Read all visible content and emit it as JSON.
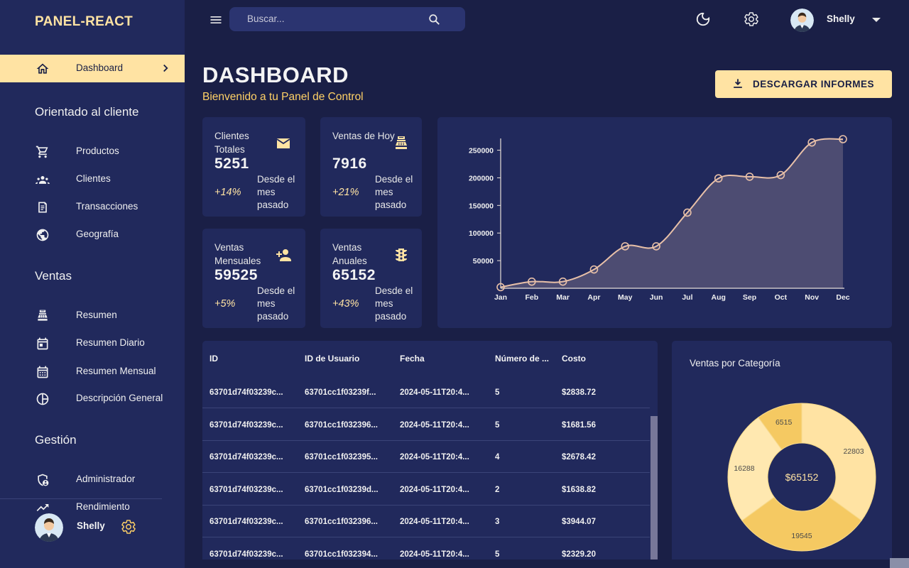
{
  "brand": "PANEL-REACT",
  "sidebar": {
    "active": {
      "label": "Dashboard"
    },
    "sections": [
      {
        "title": "Orientado al cliente",
        "items": [
          {
            "label": "Productos",
            "icon": "shopping-cart-icon"
          },
          {
            "label": "Clientes",
            "icon": "groups-icon"
          },
          {
            "label": "Transacciones",
            "icon": "receipt-icon"
          },
          {
            "label": "Geografía",
            "icon": "globe-icon"
          }
        ]
      },
      {
        "title": "Ventas",
        "items": [
          {
            "label": "Resumen",
            "icon": "point-of-sale-icon"
          },
          {
            "label": "Resumen Diario",
            "icon": "calendar-today-icon"
          },
          {
            "label": "Resumen Mensual",
            "icon": "calendar-month-icon"
          },
          {
            "label": "Descripción General",
            "icon": "pie-chart-icon"
          }
        ]
      },
      {
        "title": "Gestión",
        "items": [
          {
            "label": "Administrador",
            "icon": "admin-icon"
          },
          {
            "label": "Rendimiento",
            "icon": "trending-up-icon"
          }
        ]
      }
    ],
    "user": "Shelly"
  },
  "topbar": {
    "search_placeholder": "Buscar...",
    "user": "Shelly"
  },
  "header": {
    "title": "DASHBOARD",
    "subtitle": "Bienvenido a tu Panel de Control",
    "download_label": "DESCARGAR INFORMES"
  },
  "stats": [
    {
      "title": "Clientes Totales",
      "value": "5251",
      "increase": "+14%",
      "desc": "Desde el mes pasado",
      "icon": "email-icon"
    },
    {
      "title": "Ventas de Hoy",
      "value": "7916",
      "increase": "+21%",
      "desc": "Desde el mes pasado",
      "icon": "point-of-sale-icon"
    },
    {
      "title": "Ventas Mensuales",
      "value": "59525",
      "increase": "+5%",
      "desc": "Desde el mes pasado",
      "icon": "person-add-icon"
    },
    {
      "title": "Ventas Anuales",
      "value": "65152",
      "increase": "+43%",
      "desc": "Desde el mes pasado",
      "icon": "traffic-icon"
    }
  ],
  "chart_data": [
    {
      "type": "area",
      "x": [
        "Jan",
        "Feb",
        "Mar",
        "Apr",
        "May",
        "Jun",
        "Jul",
        "Aug",
        "Sep",
        "Oct",
        "Nov",
        "Dec"
      ],
      "series": [
        {
          "values": [
            2000,
            12000,
            12000,
            34000,
            76000,
            76000,
            137000,
            199000,
            202000,
            205000,
            264000,
            270000
          ]
        }
      ],
      "yticks": [
        "50000",
        "100000",
        "150000",
        "200000",
        "250000"
      ],
      "ylim": [
        0,
        270000
      ],
      "grid": false,
      "colors": {
        "line": "#e8c0a8",
        "fill": "#4d4c72"
      }
    },
    {
      "type": "pie",
      "title": "Ventas por Categoría",
      "center_label": "$65152",
      "slices": [
        {
          "value": 22803,
          "label": "22803",
          "color": "#ffe3a3"
        },
        {
          "value": 19545,
          "label": "19545",
          "color": "#f5c962"
        },
        {
          "value": 16288,
          "label": "16288",
          "color": "#ffe8b0"
        },
        {
          "value": 6515,
          "label": "6515",
          "color": "#f5c962"
        }
      ]
    }
  ],
  "table": {
    "headers": [
      "ID",
      "ID de Usuario",
      "Fecha",
      "Número de ...",
      "Costo"
    ],
    "rows": [
      [
        "63701d74f03239c...",
        "63701cc1f03239f...",
        "2024-05-11T20:4...",
        "5",
        "$2838.72"
      ],
      [
        "63701d74f03239c...",
        "63701cc1f032396...",
        "2024-05-11T20:4...",
        "5",
        "$1681.56"
      ],
      [
        "63701d74f03239c...",
        "63701cc1f032395...",
        "2024-05-11T20:4...",
        "4",
        "$2678.42"
      ],
      [
        "63701d74f03239c...",
        "63701cc1f03239d...",
        "2024-05-11T20:4...",
        "2",
        "$1638.82"
      ],
      [
        "63701d74f03239c...",
        "63701cc1f032396...",
        "2024-05-11T20:4...",
        "3",
        "$3944.07"
      ],
      [
        "63701d74f03239c...",
        "63701cc1f032394...",
        "2024-05-11T20:4...",
        "5",
        "$2329.20"
      ]
    ]
  }
}
